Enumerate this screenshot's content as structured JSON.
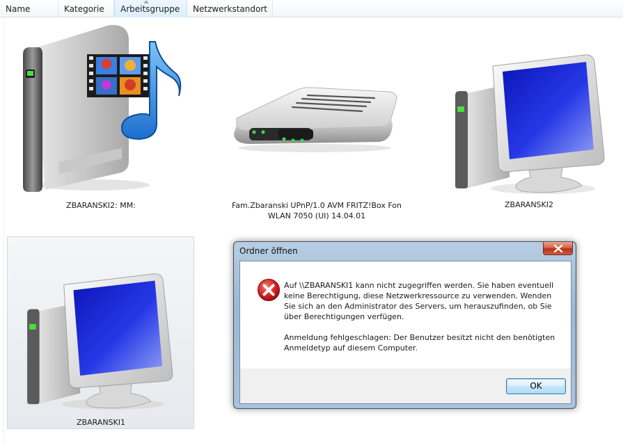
{
  "columns": [
    {
      "label": "Name"
    },
    {
      "label": "Kategorie"
    },
    {
      "label": "Arbeitsgruppe"
    },
    {
      "label": "Netzwerkstandort"
    }
  ],
  "items": [
    {
      "label": "ZBARANSKI2: MM:",
      "icon": "media-server-icon"
    },
    {
      "label_line1": "Fam.Zbaranski UPnP/1.0 AVM FRITZ!Box Fon",
      "label_line2": "WLAN 7050 (UI) 14.04.01",
      "icon": "router-icon"
    },
    {
      "label": "ZBARANSKI2",
      "icon": "computer-icon"
    },
    {
      "label": "ZBARANSKI1",
      "icon": "computer-icon",
      "selected": true
    }
  ],
  "dialog": {
    "title": "Ordner öffnen",
    "message1": "Auf \\\\ZBARANSKI1 kann nicht zugegriffen werden. Sie haben eventuell keine Berechtigung, diese Netzwerkressource zu verwenden. Wenden Sie sich an den Administrator des Servers, um herauszufinden, ob Sie über Berechtigungen verfügen.",
    "message2": "Anmeldung fehlgeschlagen: Der Benutzer besitzt nicht den benötigten Anmeldetyp auf diesem Computer.",
    "ok_label": "OK",
    "icon": "error-icon"
  },
  "colors": {
    "accent": "#3c7fb1",
    "error_red": "#c8171b",
    "screen_blue": "#1422c8"
  }
}
